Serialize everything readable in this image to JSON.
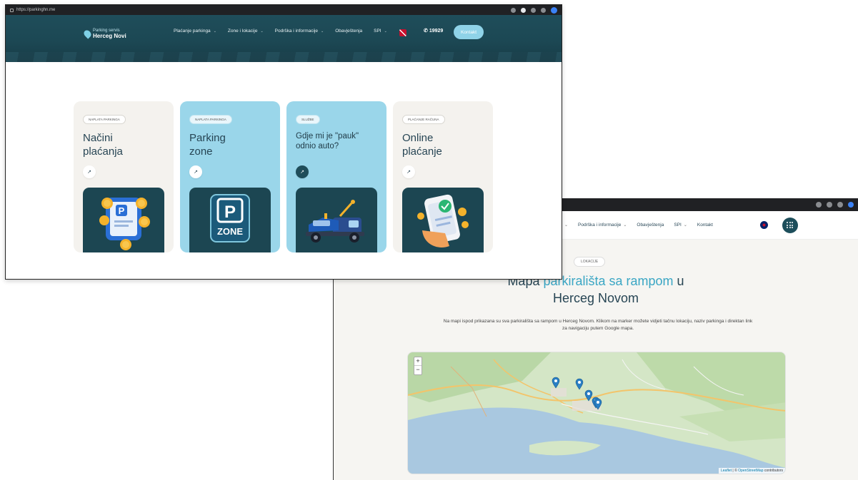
{
  "browser": {
    "url": "https://parkinghn.me"
  },
  "header": {
    "logo_line1": "Parking servis",
    "logo_line2": "Herceg Novi",
    "menu": [
      {
        "label": "Plaćanje parkinga",
        "dropdown": true
      },
      {
        "label": "Zone i lokacije",
        "dropdown": true
      },
      {
        "label": "Podrška i informacije",
        "dropdown": true
      },
      {
        "label": "Obavještenja",
        "dropdown": false
      },
      {
        "label": "SPI",
        "dropdown": true
      }
    ],
    "phone": "19929",
    "contact_label": "Kontakt"
  },
  "cards": [
    {
      "tag": "NAPLATA PARKINGA",
      "title_line1": "Načini",
      "title_line2": "plaćanja",
      "color": "#f4f2ee",
      "icon": "payment-ticket-coins-icon"
    },
    {
      "tag": "NAPLATA PARKINGA",
      "title_line1": "Parking",
      "title_line2": "zone",
      "color": "#9ad6ea",
      "icon": "parking-zone-sign-icon",
      "icon_text": "ZONE"
    },
    {
      "tag": "SLUŽBE",
      "title_line1": "Gdje mi je \"pauk\"",
      "title_line2": "odnio auto?",
      "color": "#9ad6ea",
      "icon": "tow-truck-icon"
    },
    {
      "tag": "PLAĆANJE RAČUNA",
      "title_line1": "Online",
      "title_line2": "plaćanje",
      "color": "#f4f2ee",
      "icon": "phone-payment-icon"
    }
  ],
  "map_page": {
    "nav": [
      {
        "label": "Podrška i informacije",
        "dropdown": true
      },
      {
        "label": "Obavještenja",
        "dropdown": false
      },
      {
        "label": "SPI",
        "dropdown": true
      },
      {
        "label": "Kontakt",
        "dropdown": false
      }
    ],
    "pill": "LOKACIJE",
    "title_prefix": "Mapa ",
    "title_accent": "parkirališta sa rampom",
    "title_suffix": " u",
    "title_line2": "Herceg Novom",
    "description": "Na mapi ispod prikazana su sva parkirališta sa rampom u Herceg Novom. Klikom na marker možete vidjeti tačnu lokaciju, naziv parkinga i direktan link za navigaciju putem Google mapa.",
    "zoom_in": "+",
    "zoom_out": "−",
    "attribution_leaflet": "Leaflet",
    "attribution_sep": " | © ",
    "attribution_osm": "OpenStreetMap",
    "attribution_tail": " contributors",
    "marker_count": 5
  }
}
